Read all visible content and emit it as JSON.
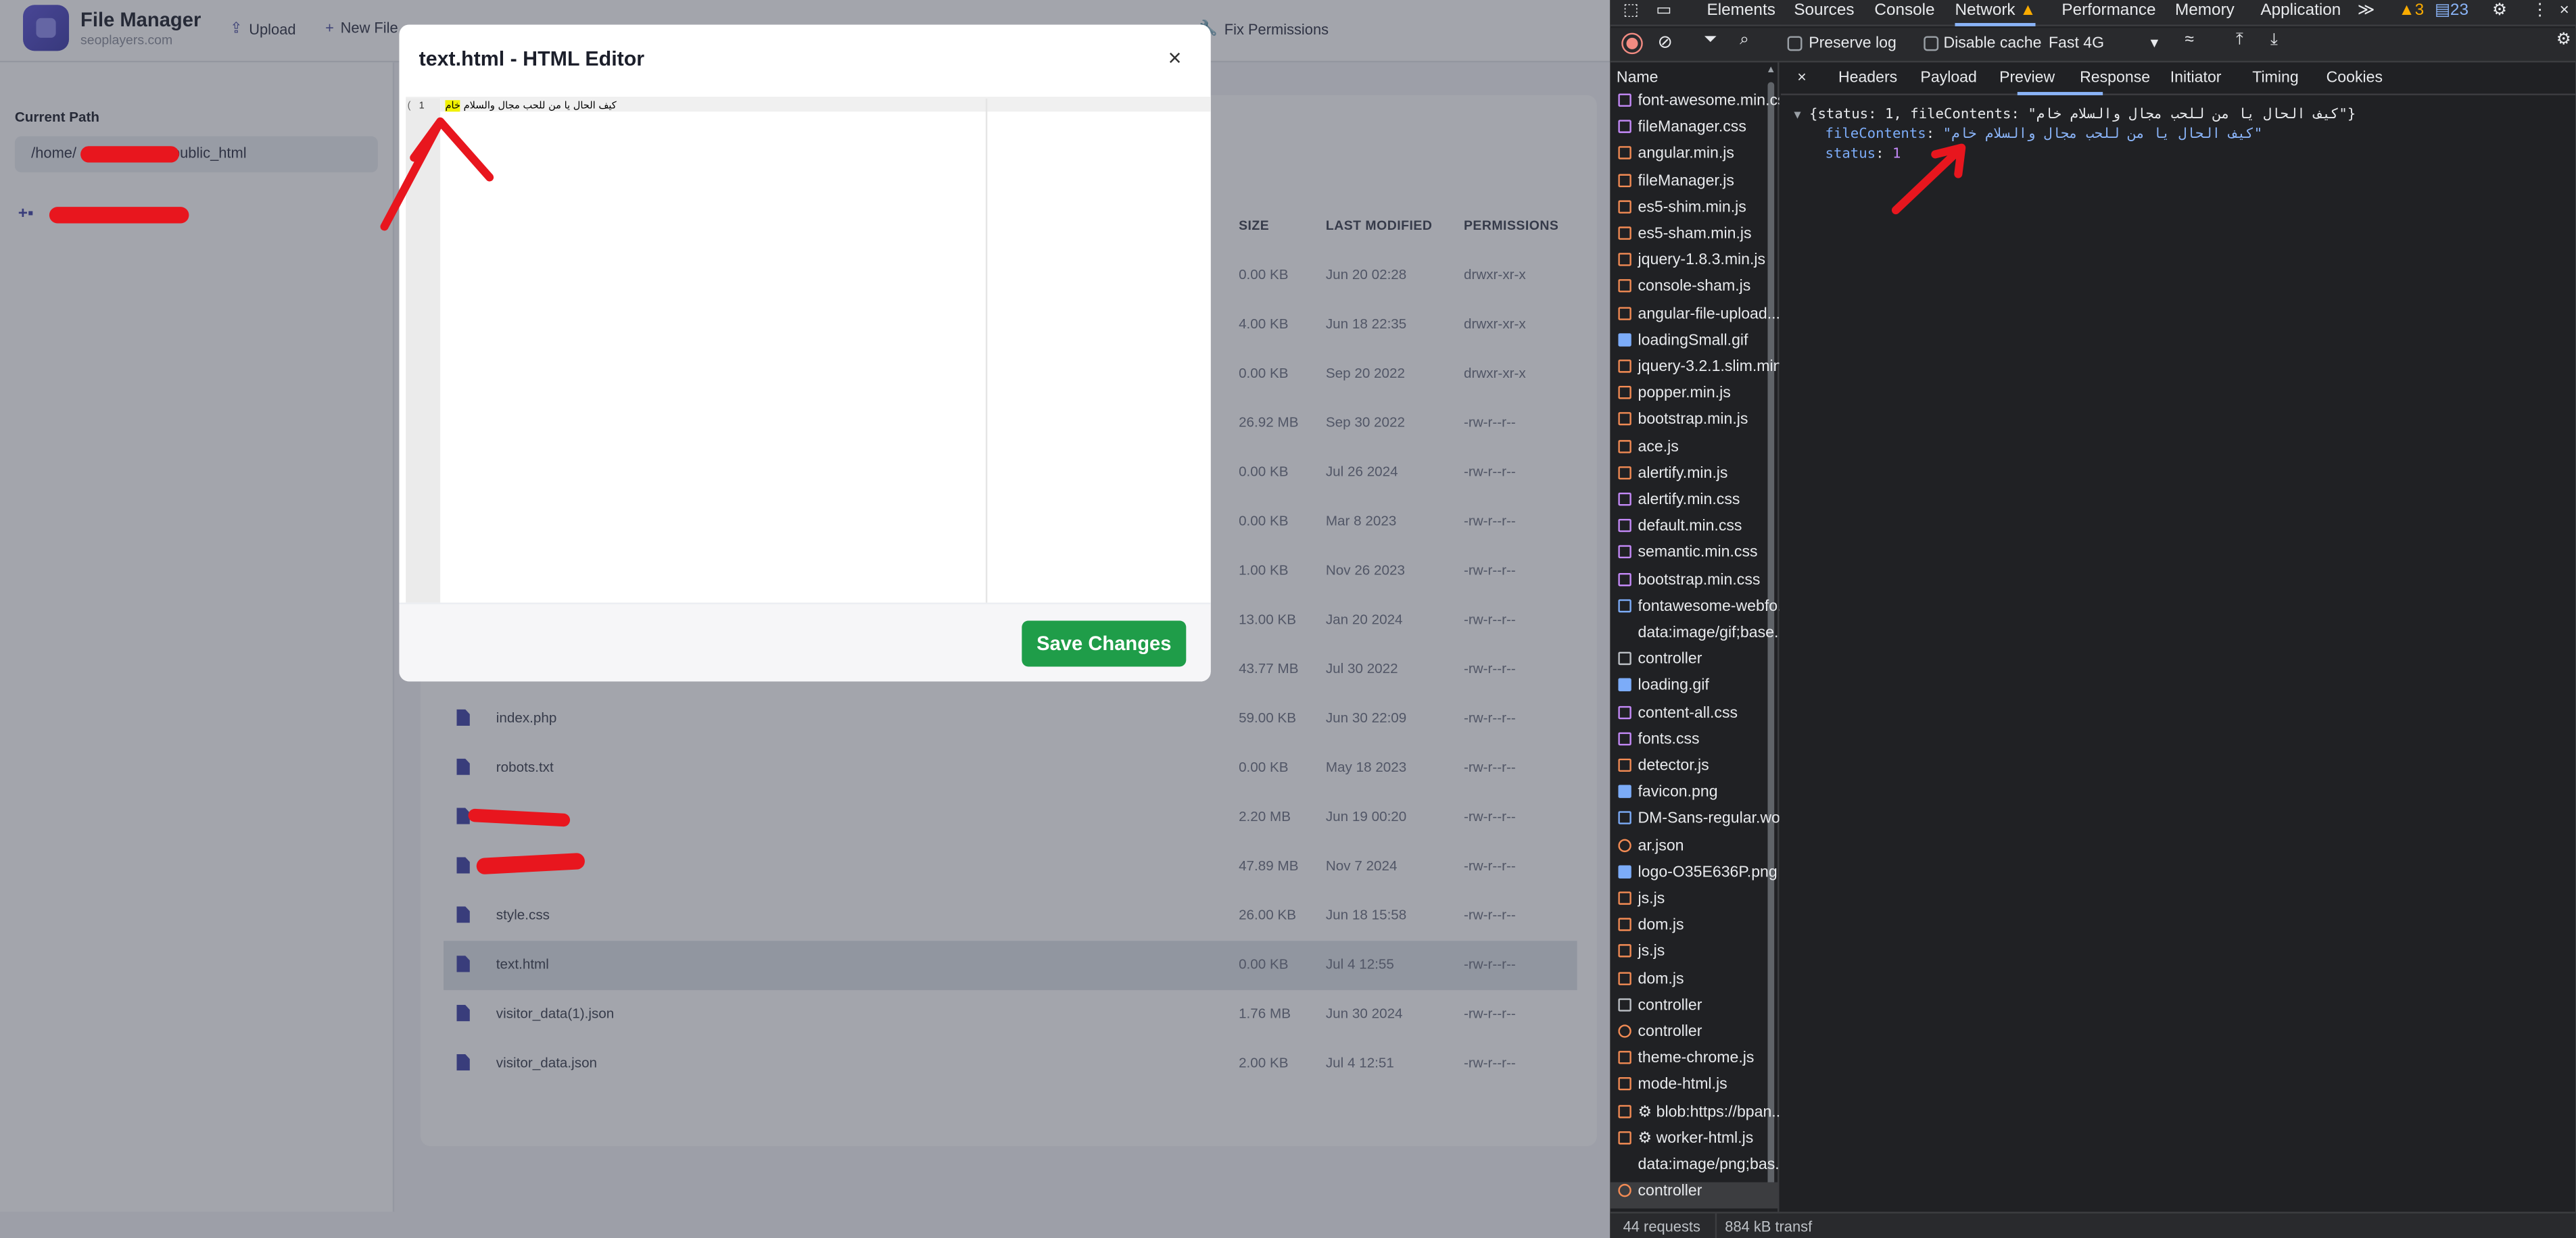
{
  "app": {
    "title": "File Manager",
    "subtitle": "seoplayers.com",
    "toolbar": {
      "upload": "Upload",
      "new_file": "New File",
      "fix_permissions": "Fix Permissions"
    },
    "current_path_label": "Current Path",
    "current_path_prefix": "/home/",
    "current_path_suffix": "m/public_html",
    "columns": {
      "size": "SIZE",
      "modified": "LAST MODIFIED",
      "permissions": "PERMISSIONS"
    },
    "rows": [
      {
        "name": "",
        "size": "0.00 KB",
        "modified": "Jun 20 02:28",
        "perm": "drwxr-xr-x"
      },
      {
        "name": "",
        "size": "4.00 KB",
        "modified": "Jun 18 22:35",
        "perm": "drwxr-xr-x"
      },
      {
        "name": "",
        "size": "0.00 KB",
        "modified": "Sep 20 2022",
        "perm": "drwxr-xr-x"
      },
      {
        "name": "",
        "size": "26.92 MB",
        "modified": "Sep 30 2022",
        "perm": "-rw-r--r--"
      },
      {
        "name": "",
        "size": "0.00 KB",
        "modified": "Jul 26 2024",
        "perm": "-rw-r--r--"
      },
      {
        "name": "",
        "size": "0.00 KB",
        "modified": "Mar 8 2023",
        "perm": "-rw-r--r--"
      },
      {
        "name": "",
        "size": "1.00 KB",
        "modified": "Nov 26 2023",
        "perm": "-rw-r--r--"
      },
      {
        "name": "",
        "size": "13.00 KB",
        "modified": "Jan 20 2024",
        "perm": "-rw-r--r--"
      },
      {
        "name": "",
        "size": "43.77 MB",
        "modified": "Jul 30 2022",
        "perm": "-rw-r--r--"
      },
      {
        "name": "index.php",
        "size": "59.00 KB",
        "modified": "Jun 30 22:09",
        "perm": "-rw-r--r--"
      },
      {
        "name": "robots.txt",
        "size": "0.00 KB",
        "modified": "May 18 2023",
        "perm": "-rw-r--r--"
      },
      {
        "name": "",
        "size": "2.20 MB",
        "modified": "Jun 19 00:20",
        "perm": "-rw-r--r--"
      },
      {
        "name": "",
        "size": "47.89 MB",
        "modified": "Nov 7 2024",
        "perm": "-rw-r--r--"
      },
      {
        "name": "style.css",
        "size": "26.00 KB",
        "modified": "Jun 18 15:58",
        "perm": "-rw-r--r--"
      },
      {
        "name": "text.html",
        "size": "0.00 KB",
        "modified": "Jul 4 12:55",
        "perm": "-rw-r--r--"
      },
      {
        "name": "visitor_data(1).json",
        "size": "1.76 MB",
        "modified": "Jun 30 2024",
        "perm": "-rw-r--r--"
      },
      {
        "name": "visitor_data.json",
        "size": "2.00 KB",
        "modified": "Jul 4 12:51",
        "perm": "-rw-r--r--"
      }
    ]
  },
  "modal": {
    "title": "text.html - HTML Editor",
    "close": "×",
    "line_number": "1",
    "fold_mark": "(",
    "code_text": "كيف الحال يا من للحب مجال والسلام",
    "code_highlight": "خام",
    "save_label": "Save Changes"
  },
  "devtools": {
    "tabs": [
      "Elements",
      "Sources",
      "Console",
      "Network",
      "Performance",
      "Memory",
      "Application"
    ],
    "more_tabs": "≫",
    "warnings": "3",
    "messages": "23",
    "preserve_log": "Preserve log",
    "disable_cache": "Disable cache",
    "throttle": "Fast 4G",
    "name_header": "Name",
    "subtabs": [
      "Headers",
      "Payload",
      "Preview",
      "Response",
      "Initiator",
      "Timing",
      "Cookies"
    ],
    "close": "×",
    "requests": [
      {
        "name": "font-awesome.min.css",
        "type": "css"
      },
      {
        "name": "fileManager.css",
        "type": "css"
      },
      {
        "name": "angular.min.js",
        "type": "js"
      },
      {
        "name": "fileManager.js",
        "type": "js"
      },
      {
        "name": "es5-shim.min.js",
        "type": "js"
      },
      {
        "name": "es5-sham.min.js",
        "type": "js"
      },
      {
        "name": "jquery-1.8.3.min.js",
        "type": "js"
      },
      {
        "name": "console-sham.js",
        "type": "js"
      },
      {
        "name": "angular-file-upload....",
        "type": "js"
      },
      {
        "name": "loadingSmall.gif",
        "type": "img"
      },
      {
        "name": "jquery-3.2.1.slim.min...",
        "type": "js"
      },
      {
        "name": "popper.min.js",
        "type": "js"
      },
      {
        "name": "bootstrap.min.js",
        "type": "js"
      },
      {
        "name": "ace.js",
        "type": "js"
      },
      {
        "name": "alertify.min.js",
        "type": "js"
      },
      {
        "name": "alertify.min.css",
        "type": "css"
      },
      {
        "name": "default.min.css",
        "type": "css"
      },
      {
        "name": "semantic.min.css",
        "type": "css"
      },
      {
        "name": "bootstrap.min.css",
        "type": "css"
      },
      {
        "name": "fontawesome-webfo...",
        "type": "font"
      },
      {
        "name": "data:image/gif;base...",
        "type": "none"
      },
      {
        "name": "controller",
        "type": "doc"
      },
      {
        "name": "loading.gif",
        "type": "img"
      },
      {
        "name": "content-all.css",
        "type": "css"
      },
      {
        "name": "fonts.css",
        "type": "css"
      },
      {
        "name": "detector.js",
        "type": "js"
      },
      {
        "name": "favicon.png",
        "type": "img"
      },
      {
        "name": "DM-Sans-regular.wo...",
        "type": "font"
      },
      {
        "name": "ar.json",
        "type": "json"
      },
      {
        "name": "logo-O35E636P.png",
        "type": "img"
      },
      {
        "name": "js.js",
        "type": "js"
      },
      {
        "name": "dom.js",
        "type": "js"
      },
      {
        "name": "js.js",
        "type": "js"
      },
      {
        "name": "dom.js",
        "type": "js"
      },
      {
        "name": "controller",
        "type": "doc"
      },
      {
        "name": "controller",
        "type": "json"
      },
      {
        "name": "theme-chrome.js",
        "type": "js"
      },
      {
        "name": "mode-html.js",
        "type": "js"
      },
      {
        "name": "⚙ blob:https://bpan...",
        "type": "js"
      },
      {
        "name": "⚙ worker-html.js",
        "type": "js"
      },
      {
        "name": "data:image/png;bas...",
        "type": "none"
      },
      {
        "name": "controller",
        "type": "json"
      }
    ],
    "preview": {
      "root": "{status: 1, fileContents: \"كيف الحال يا من للحب مجال والسلام خام\"}",
      "key1": "fileContents",
      "val1": "\"كيف الحال يا من للحب مجال والسلام خام\"",
      "key2": "status",
      "val2": "1"
    },
    "status_requests": "44 requests",
    "status_transfer": "884 kB transf"
  }
}
